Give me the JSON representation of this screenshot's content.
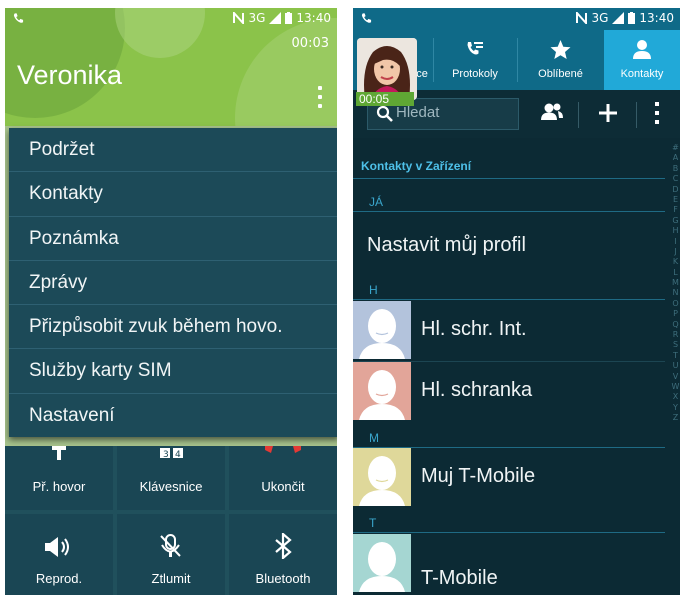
{
  "left": {
    "status": {
      "time": "13:40",
      "network": "3G"
    },
    "call": {
      "timer": "00:03",
      "caller_name": "Veronika"
    },
    "menu_items": [
      "Podržet",
      "Kontakty",
      "Poznámka",
      "Zprávy",
      "Přizpůsobit zvuk během hovo.",
      "Služby karty SIM",
      "Nastavení"
    ],
    "buttons": [
      {
        "label": "Př. hovor",
        "icon": "add-call-icon"
      },
      {
        "label": "Klávesnice",
        "icon": "keypad-icon"
      },
      {
        "label": "Ukončit",
        "icon": "end-call-icon"
      },
      {
        "label": "Reprod.",
        "icon": "speaker-icon"
      },
      {
        "label": "Ztlumit",
        "icon": "mute-icon"
      },
      {
        "label": "Bluetooth",
        "icon": "bluetooth-icon"
      }
    ],
    "colors": {
      "header": "#8bc34a",
      "menu": "#1c4a58",
      "end_call": "#e53935"
    }
  },
  "right": {
    "status": {
      "time": "13:40",
      "network": "3G"
    },
    "tabs": [
      {
        "label": "ce",
        "icon": ""
      },
      {
        "label": "Protokoly",
        "icon": "call-log-icon"
      },
      {
        "label": "Oblíbené",
        "icon": "star-icon"
      },
      {
        "label": "Kontakty",
        "icon": "person-icon",
        "active": true
      }
    ],
    "call_chip": "00:05",
    "search_placeholder": "Hledat",
    "section_title": "Kontakty v Zařízení",
    "groups": [
      {
        "letter": "JÁ",
        "rows": [
          "Nastavit můj profil"
        ]
      },
      {
        "letter": "H",
        "rows": [
          "Hl. schr. Int.",
          "Hl. schranka"
        ]
      },
      {
        "letter": "M",
        "rows": [
          "Muj T-Mobile"
        ]
      },
      {
        "letter": "T",
        "rows": [
          "T-Mobile"
        ]
      }
    ],
    "index_letters": [
      "#",
      "A",
      "B",
      "C",
      "D",
      "E",
      "F",
      "G",
      "H",
      "I",
      "J",
      "K",
      "L",
      "M",
      "N",
      "O",
      "P",
      "Q",
      "R",
      "S",
      "T",
      "U",
      "V",
      "W",
      "X",
      "Y",
      "Z"
    ],
    "colors": {
      "tabs_bg": "#0f6a88",
      "active_tab": "#21a9d8",
      "accent": "#4ec0e8"
    }
  }
}
